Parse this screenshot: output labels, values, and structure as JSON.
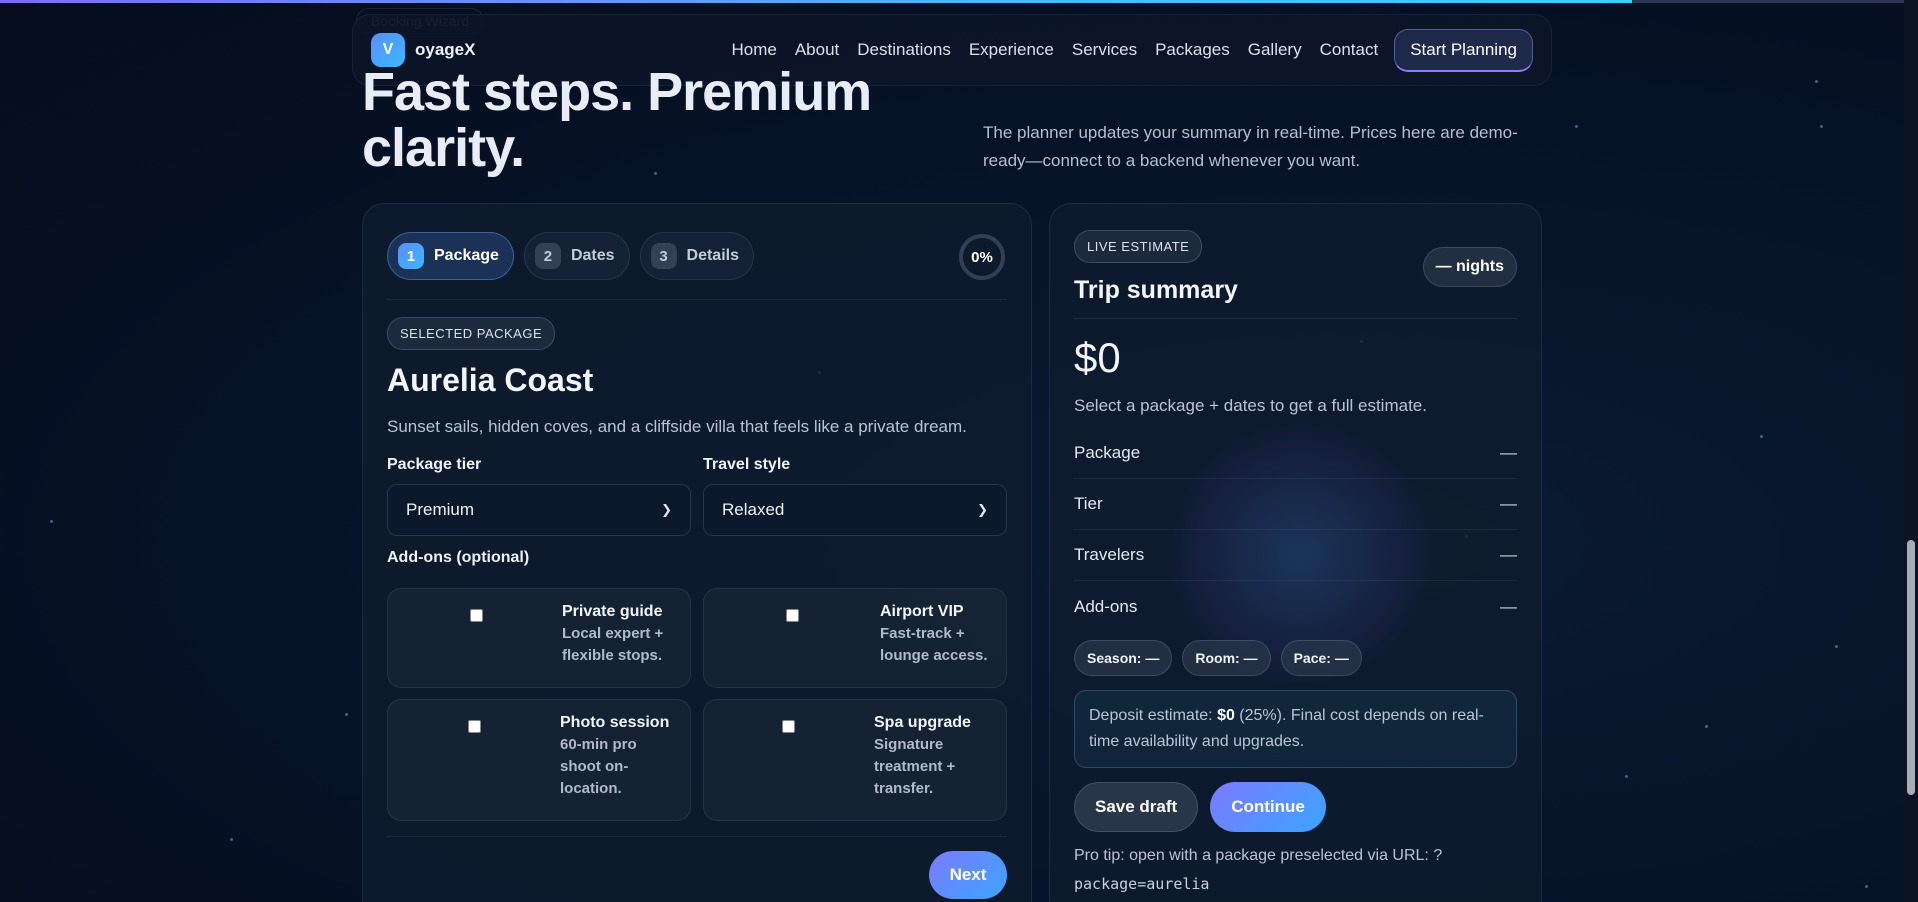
{
  "nav": {
    "logo_letter": "V",
    "brand": "oyageX",
    "ghost_label": "Booking Wizard",
    "links": [
      "Home",
      "About",
      "Destinations",
      "Experience",
      "Services",
      "Packages",
      "Gallery",
      "Contact"
    ],
    "cta": "Start Planning"
  },
  "hero": {
    "title": "Fast steps. Premium clarity.",
    "description": "The planner updates your summary in real-time. Prices here are demo-ready—connect to a backend whenever you want."
  },
  "wizard": {
    "steps": [
      {
        "num": "1",
        "label": "Package"
      },
      {
        "num": "2",
        "label": "Dates"
      },
      {
        "num": "3",
        "label": "Details"
      }
    ],
    "progress": "0%",
    "selected_tag": "SELECTED PACKAGE",
    "package_name": "Aurelia Coast",
    "package_desc": "Sunset sails, hidden coves, and a cliffside villa that feels like a private dream.",
    "tier_label": "Package tier",
    "tier_value": "Premium",
    "style_label": "Travel style",
    "style_value": "Relaxed",
    "addons_label": "Add-ons (optional)",
    "addons": [
      {
        "title": "Private guide",
        "sub": "Local expert + flexible stops."
      },
      {
        "title": "Airport VIP",
        "sub": "Fast-track + lounge access."
      },
      {
        "title": "Photo session",
        "sub": "60-min pro shoot on-location."
      },
      {
        "title": "Spa upgrade",
        "sub": "Signature treatment + transfer."
      }
    ],
    "next": "Next"
  },
  "summary": {
    "tag": "LIVE ESTIMATE",
    "title": "Trip summary",
    "nights": "— nights",
    "price": "$0",
    "price_note": "Select a package + dates to get a full estimate.",
    "rows": [
      {
        "label": "Package",
        "value": "—"
      },
      {
        "label": "Tier",
        "value": "—"
      },
      {
        "label": "Travelers",
        "value": "—"
      },
      {
        "label": "Add-ons",
        "value": "—"
      }
    ],
    "chips": [
      "Season: —",
      "Room: —",
      "Pace: —"
    ],
    "deposit_prefix": "Deposit estimate: ",
    "deposit_amount": "$0",
    "deposit_suffix": " (25%). Final cost depends on real-time availability and upgrades.",
    "save_draft": "Save draft",
    "continue": "Continue",
    "tip_text": "Pro tip: open with a package preselected via URL: ?",
    "tip_code": "package=aurelia"
  },
  "colors": {
    "accent_start": "#7d79ff",
    "accent_end": "#3aa5ff",
    "background": "#050d1d"
  }
}
